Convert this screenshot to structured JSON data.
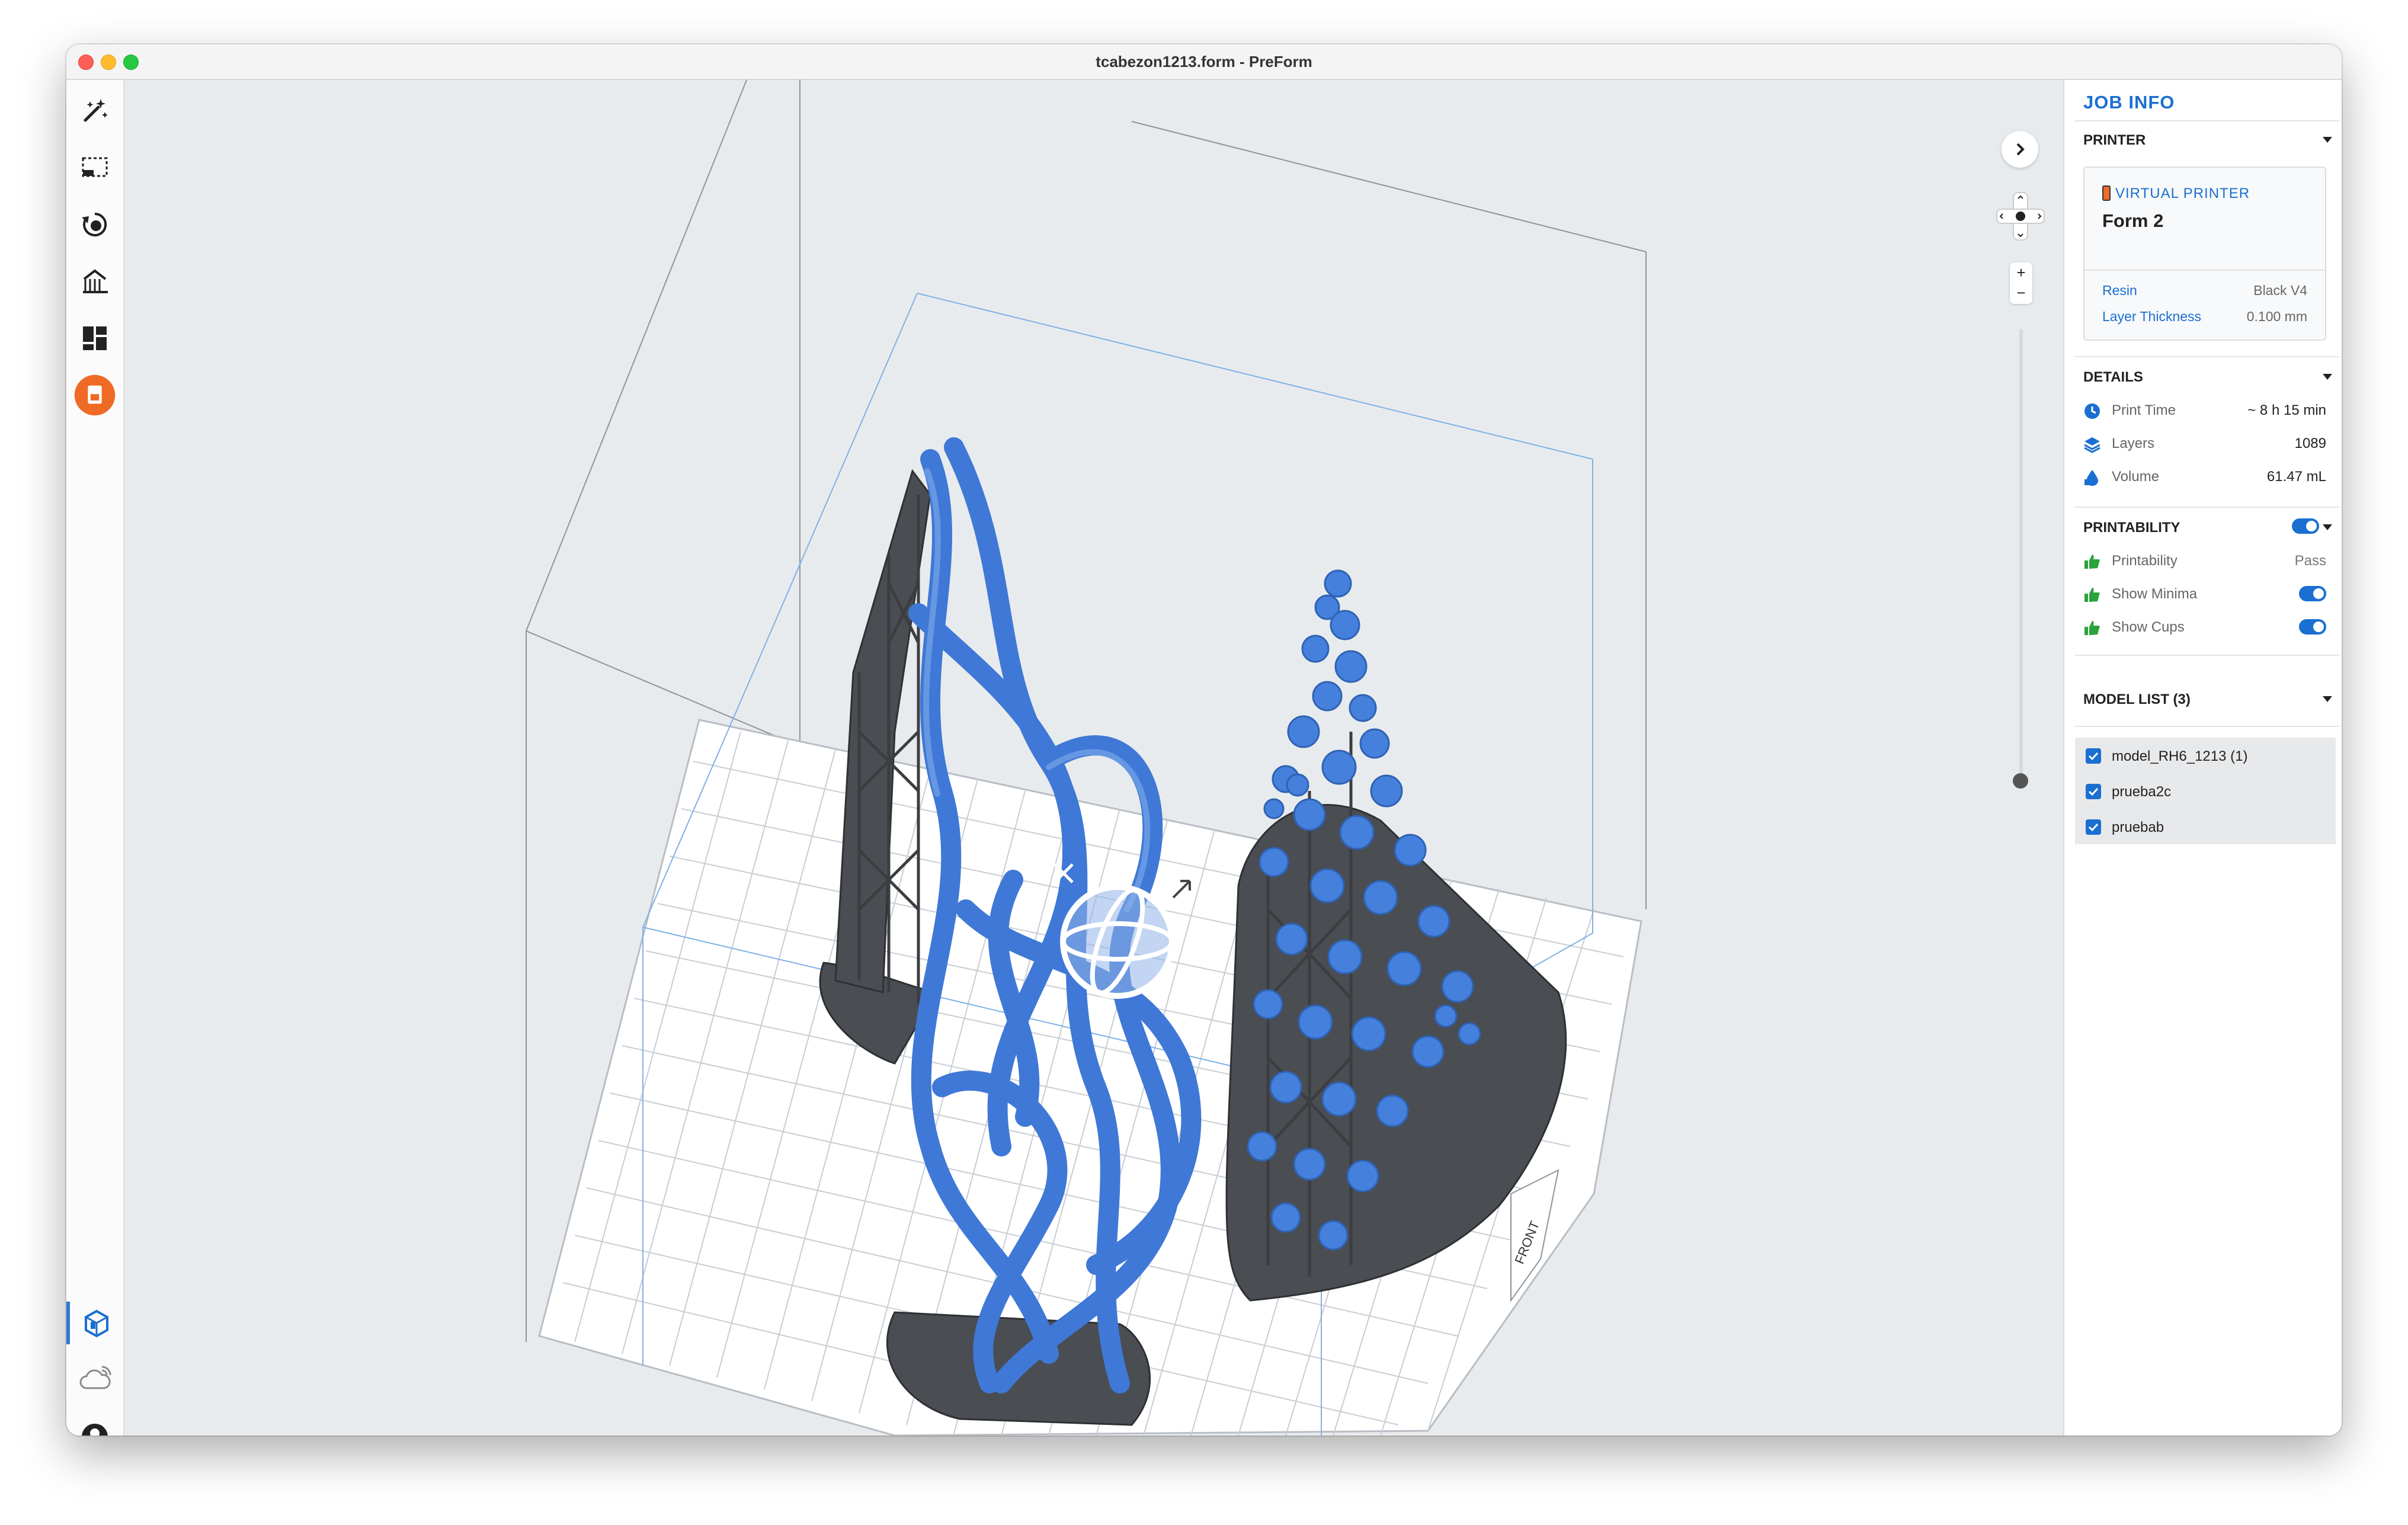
{
  "window": {
    "title": "tcabezon1213.form - PreForm"
  },
  "toolbar": {
    "tools": [
      {
        "name": "magic-wand-icon"
      },
      {
        "name": "select-icon"
      },
      {
        "name": "orientation-icon"
      },
      {
        "name": "supports-icon"
      },
      {
        "name": "layout-icon"
      },
      {
        "name": "print-icon"
      }
    ],
    "bottom": [
      {
        "name": "local-printer-icon"
      },
      {
        "name": "cloud-icon"
      },
      {
        "name": "account-icon"
      }
    ]
  },
  "viewport": {
    "front_label": "FRONT",
    "zoom_in": "+",
    "zoom_out": "−",
    "model_colors": {
      "model": "#3f78d6",
      "supports": "#4a4d52"
    }
  },
  "panel": {
    "title": "JOB INFO",
    "printer": {
      "header": "PRINTER",
      "virtual_label": "VIRTUAL PRINTER",
      "name": "Form 2",
      "resin_label": "Resin",
      "resin_value": "Black V4",
      "layer_label": "Layer Thickness",
      "layer_value": "0.100 mm"
    },
    "details": {
      "header": "DETAILS",
      "print_time_label": "Print Time",
      "print_time_value": "~ 8 h 15 min",
      "layers_label": "Layers",
      "layers_value": "1089",
      "volume_label": "Volume",
      "volume_value": "61.47 mL"
    },
    "printability": {
      "header": "PRINTABILITY",
      "printability_label": "Printability",
      "printability_value": "Pass",
      "minima_label": "Show Minima",
      "cups_label": "Show Cups"
    },
    "model_list": {
      "header": "MODEL LIST (3)",
      "items": [
        "model_RH6_1213 (1)",
        "prueba2c",
        "pruebab"
      ]
    }
  },
  "colors": {
    "accent": "#1a6fd1",
    "print_button": "#ef6a24",
    "ok": "#2aa33a"
  }
}
